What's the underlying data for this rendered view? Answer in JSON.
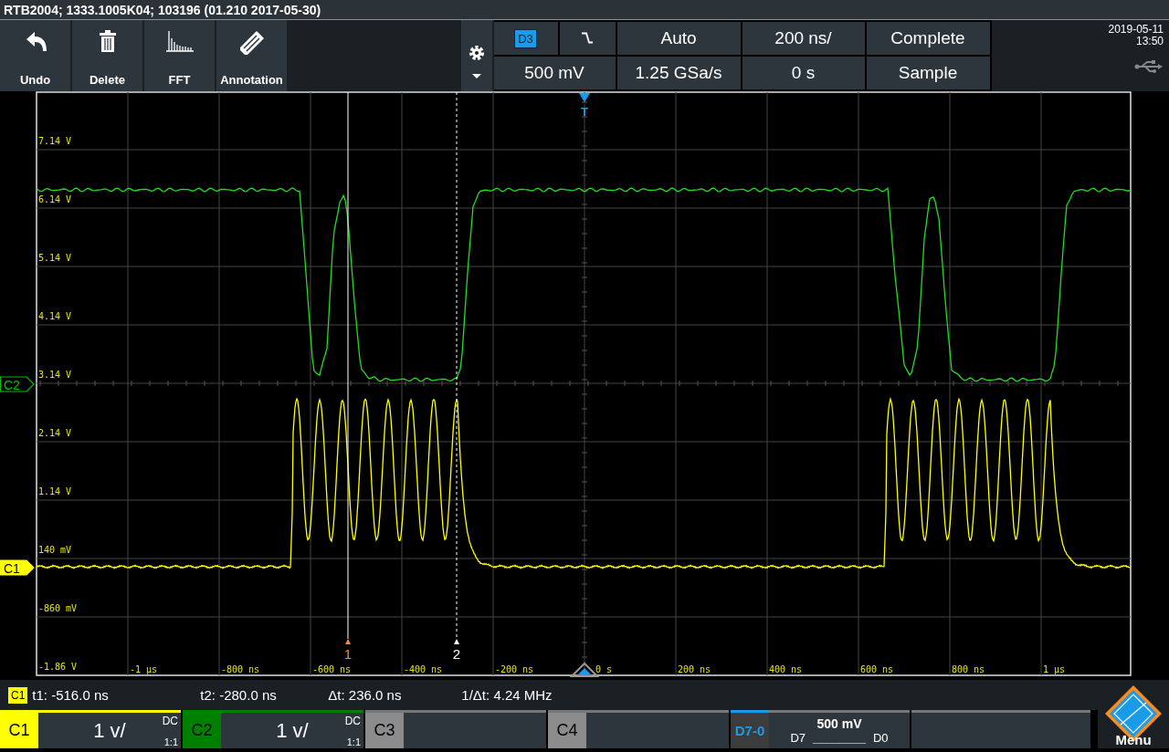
{
  "title_bar": {
    "text": "RTB2004; 1333.1005K04; 103196 (01.210 2017-05-30)"
  },
  "toolbar": {
    "buttons": [
      {
        "label": "Undo",
        "kind": "undo"
      },
      {
        "label": "Delete",
        "kind": "delete"
      },
      {
        "label": "FFT",
        "kind": "fft"
      },
      {
        "label": "Annotation",
        "kind": "annotation"
      }
    ]
  },
  "settings": {
    "source_badge": "D3",
    "trigger_mode": "Auto",
    "timebase": "200 ns/",
    "acquisition": "Complete",
    "trigger_level": "500 mV",
    "sample_rate": "1.25 GSa/s",
    "position": "0 s",
    "mode": "Sample"
  },
  "clock": {
    "date": "2019-05-11",
    "time": "13:50"
  },
  "plot": {
    "y_labels": [
      "7.14 V",
      "6.14 V",
      "5.14 V",
      "4.14 V",
      "3.14 V",
      "2.14 V",
      "1.14 V",
      "140 mV",
      "-860 mV",
      "-1.86 V"
    ],
    "x_labels": [
      "-1 µs",
      "-800 ns",
      "-600 ns",
      "-400 ns",
      "-200 ns",
      "0 s",
      "200 ns",
      "400 ns",
      "600 ns",
      "800 ns",
      "1 µs"
    ],
    "channel_markers": [
      {
        "label": "C2",
        "kind": "outline",
        "color": "#00c000"
      },
      {
        "label": "C1",
        "kind": "filled",
        "color": "#ffff00"
      }
    ],
    "cursors": [
      {
        "label": "1",
        "kind": "solid",
        "color": "#ff8c1a"
      },
      {
        "label": "2",
        "kind": "dashed",
        "color": "#ffffff"
      }
    ],
    "trigger_label": "T"
  },
  "cursor_info": {
    "badge": "C1",
    "items": [
      "t1: -516.0 ns",
      "t2: -280.0 ns",
      "Δt: 236.0 ns",
      "1/Δt: 4.24 MHz"
    ]
  },
  "channels": [
    {
      "label": "C1",
      "kind": "analog",
      "on": true,
      "color": "#ffff00",
      "scale": "1 v/",
      "coupling": "DC",
      "probe": "1:1"
    },
    {
      "label": "C2",
      "kind": "analog",
      "on": true,
      "color": "#008000",
      "scale": "1 v/",
      "coupling": "DC",
      "probe": "1:1"
    },
    {
      "label": "C3",
      "kind": "analog",
      "on": false
    },
    {
      "label": "C4",
      "kind": "analog",
      "on": false
    },
    {
      "label": "D7-0",
      "kind": "digital",
      "on": false,
      "color": "#1a9be8",
      "scale": "500 mV",
      "range_high": "D7",
      "bus_line": "________",
      "range_low": "D0"
    }
  ],
  "menu": {
    "label": "Menu"
  }
}
